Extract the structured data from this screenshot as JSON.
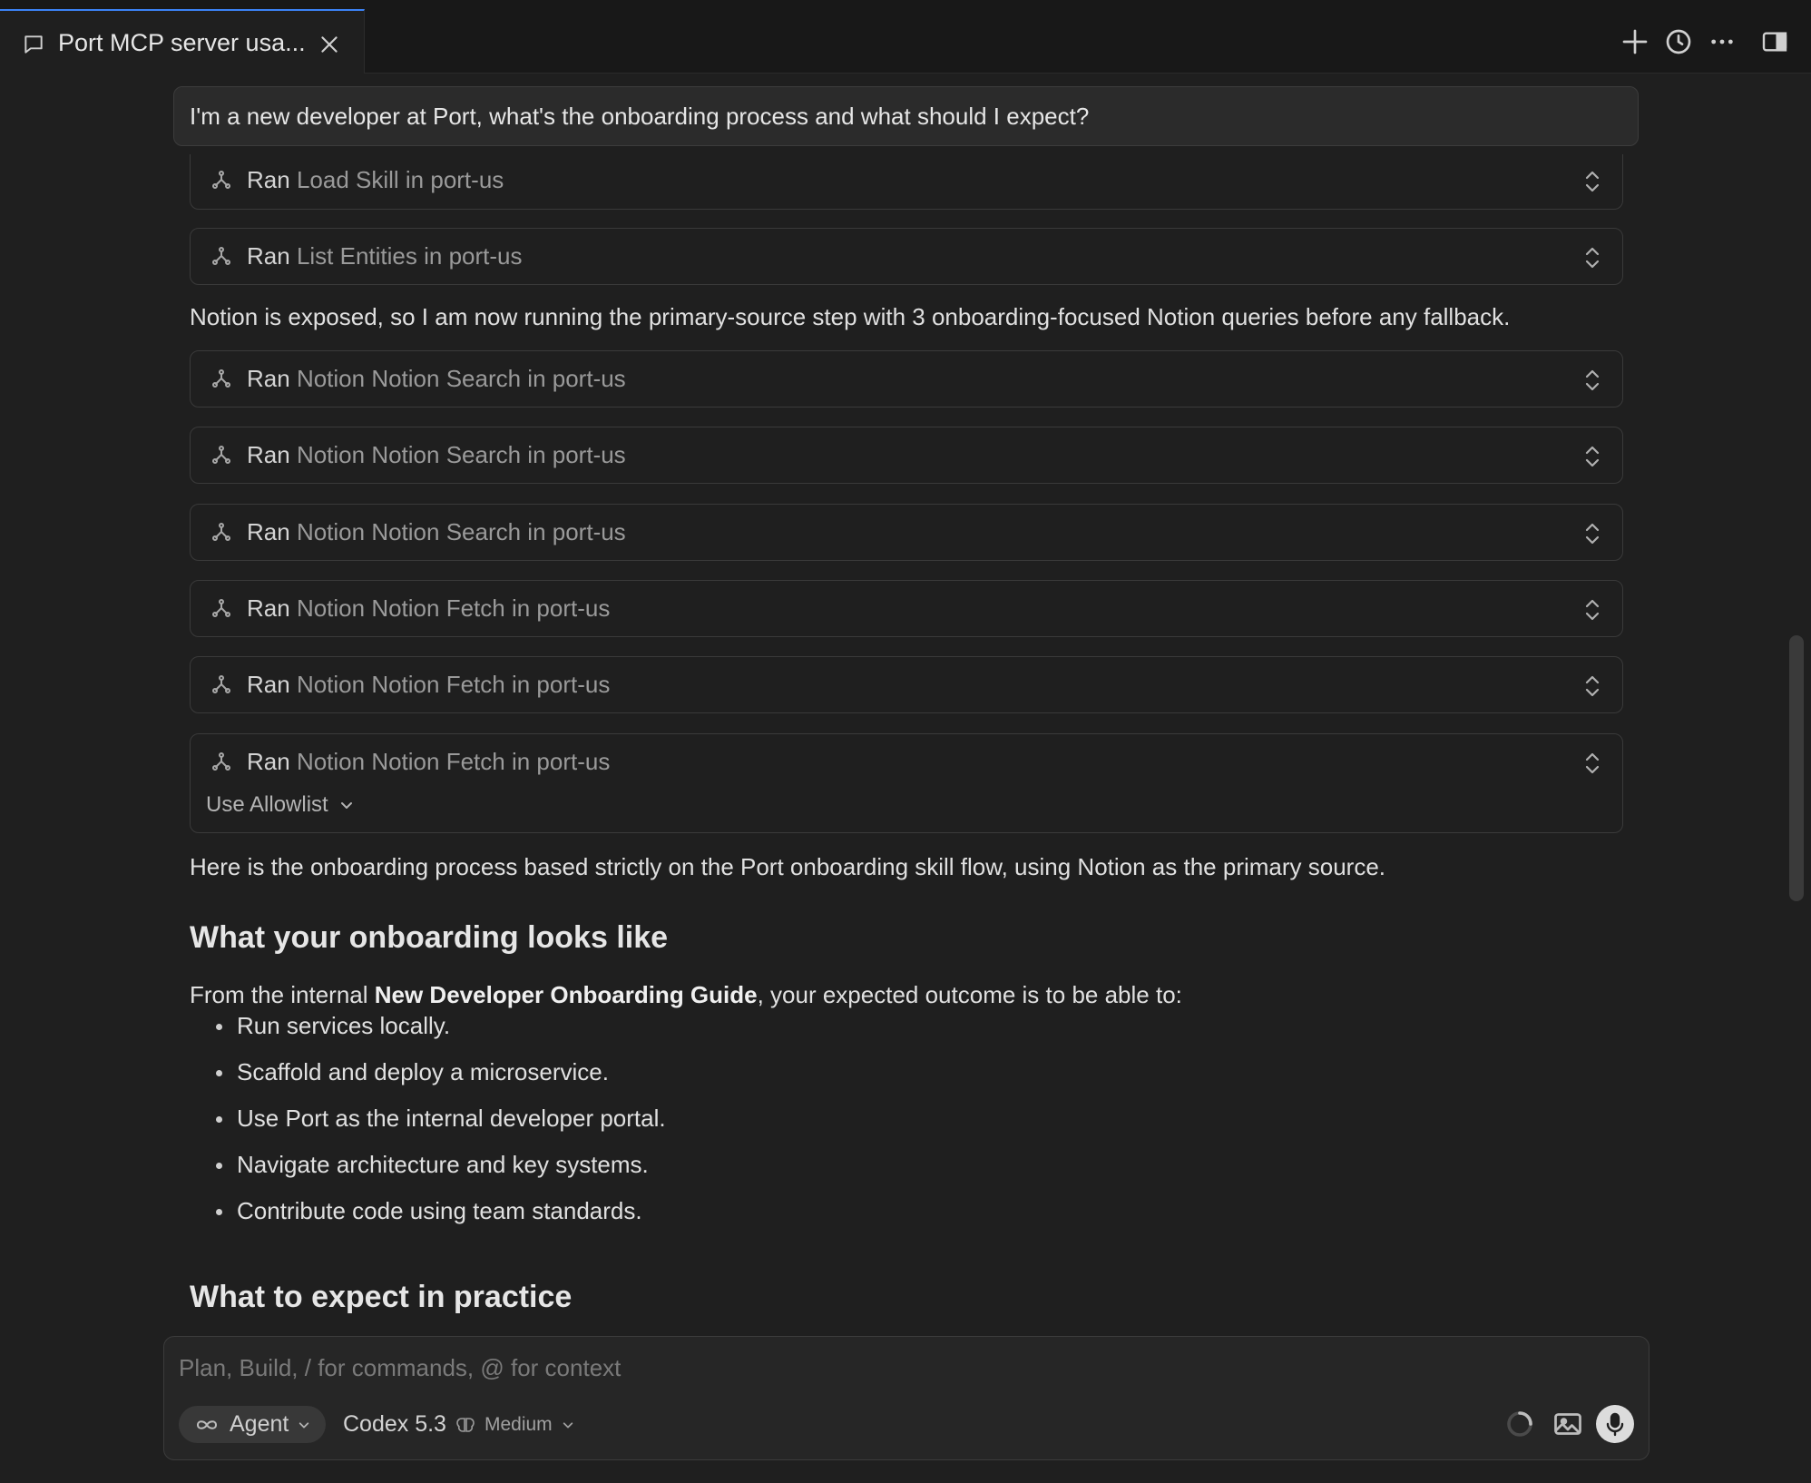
{
  "tab": {
    "title": "Port MCP server usa...",
    "icons": {
      "tab": "chat-bubble-icon",
      "close": "close-icon"
    }
  },
  "toolbar": {
    "icons": [
      "plus-icon",
      "history-icon",
      "more-icon",
      "toggle-panel-icon"
    ]
  },
  "conversation": {
    "user_message": "I'm a new developer at Port, what's the onboarding process and what should I expect?",
    "tool_calls_top": [
      {
        "verb": "Ran",
        "name": "Load Skill in port-us"
      },
      {
        "verb": "Ran",
        "name": "List Entities in port-us"
      }
    ],
    "status_text": "Notion is exposed, so I am now running the primary-source step with 3 onboarding-focused Notion queries before any fallback.",
    "tool_calls_notion": [
      {
        "verb": "Ran",
        "name": "Notion Notion Search in port-us"
      },
      {
        "verb": "Ran",
        "name": "Notion Notion Search in port-us"
      },
      {
        "verb": "Ran",
        "name": "Notion Notion Search in port-us"
      },
      {
        "verb": "Ran",
        "name": "Notion Notion Fetch in port-us"
      },
      {
        "verb": "Ran",
        "name": "Notion Notion Fetch in port-us"
      },
      {
        "verb": "Ran",
        "name": "Notion Notion Fetch in port-us"
      }
    ],
    "allowlist_label": "Use Allowlist",
    "intro": "Here is the onboarding process based strictly on the Port onboarding skill flow, using Notion as the primary source.",
    "heading_1": "What your onboarding looks like",
    "guide_prefix": "From the internal ",
    "guide_name": "New Developer Onboarding Guide",
    "guide_suffix": ", your expected outcome is to be able to:",
    "outcomes": [
      "Run services locally.",
      "Scaffold and deploy a microservice.",
      "Use Port as the internal developer portal.",
      "Navigate architecture and key systems.",
      "Contribute code using team standards."
    ],
    "heading_2": "What to expect in practice"
  },
  "composer": {
    "placeholder": "Plan, Build, / for commands, @ for context",
    "mode_label": "Agent",
    "model": "Codex 5.3",
    "effort": "Medium",
    "icons": [
      "infinity-icon",
      "chevron-down-icon",
      "brain-icon",
      "spinner-icon",
      "image-icon",
      "microphone-icon"
    ]
  }
}
